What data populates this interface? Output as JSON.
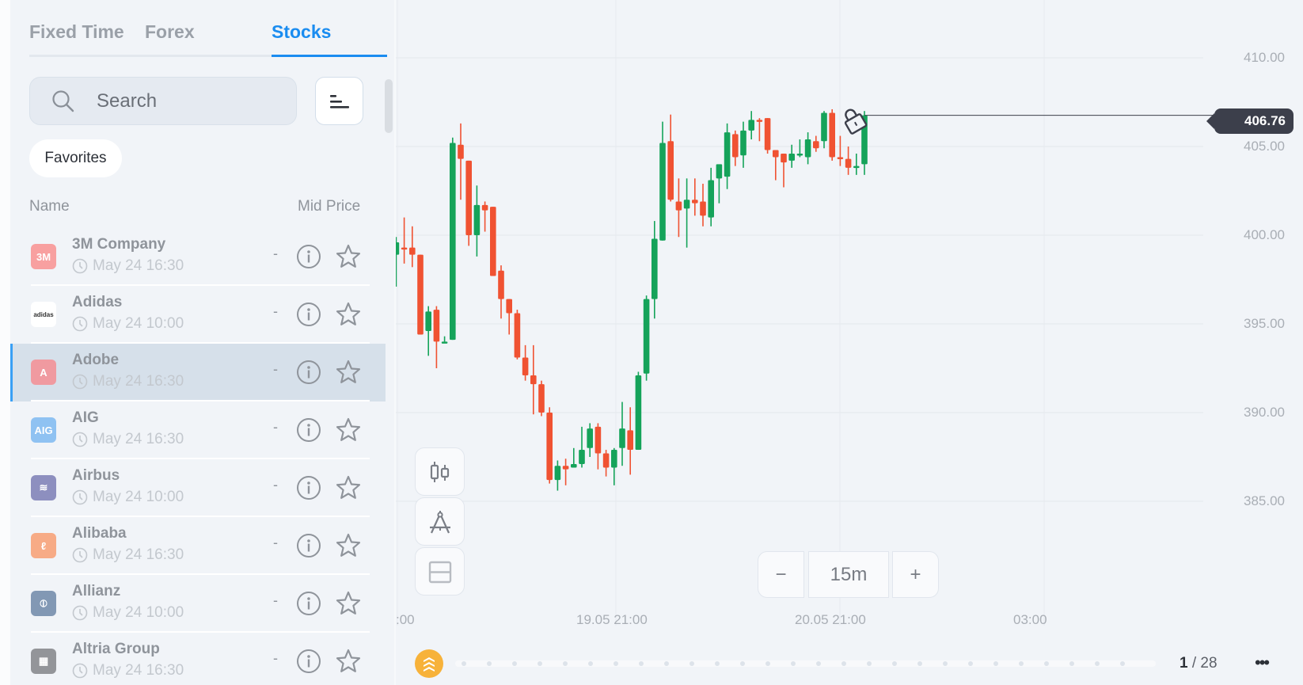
{
  "sidebar": {
    "tabs": [
      {
        "label": "Fixed Time",
        "active": false
      },
      {
        "label": "Forex",
        "active": false
      },
      {
        "label": "Stocks",
        "active": true
      }
    ],
    "search": {
      "placeholder": "Search",
      "value": ""
    },
    "sort_icon": "sort-lines-icon",
    "favorites_label": "Favorites",
    "columns": {
      "name": "Name",
      "price": "Mid Price"
    },
    "items": [
      {
        "name": "3M Company",
        "time": "May 24 16:30",
        "price": "-",
        "logo_text": "3M",
        "logo_color": "#f8a0a0",
        "selected": false
      },
      {
        "name": "Adidas",
        "time": "May 24 10:00",
        "price": "-",
        "logo_text": "adidas",
        "logo_color": "#ffffff",
        "selected": false
      },
      {
        "name": "Adobe",
        "time": "May 24 16:30",
        "price": "-",
        "logo_text": "A",
        "logo_color": "#f09aa0",
        "selected": true
      },
      {
        "name": "AIG",
        "time": "May 24 16:30",
        "price": "-",
        "logo_text": "AIG",
        "logo_color": "#8fc2f2",
        "selected": false
      },
      {
        "name": "Airbus",
        "time": "May 24 10:00",
        "price": "-",
        "logo_text": "≋",
        "logo_color": "#8d8fbf",
        "selected": false
      },
      {
        "name": "Alibaba",
        "time": "May 24 16:30",
        "price": "-",
        "logo_text": "ℓ",
        "logo_color": "#f7ab86",
        "selected": false
      },
      {
        "name": "Allianz",
        "time": "May 24 10:00",
        "price": "-",
        "logo_text": "⦶",
        "logo_color": "#8298b4",
        "selected": false
      },
      {
        "name": "Altria Group",
        "time": "May 24 16:30",
        "price": "-",
        "logo_text": "▦",
        "logo_color": "#939599",
        "selected": false
      }
    ]
  },
  "chart": {
    "current_price": "406.76",
    "y_ticks": [
      "410.00",
      "405.00",
      "400.00",
      "395.00",
      "390.00",
      "385.00"
    ],
    "x_ticks": [
      ":00",
      "19.05 21:00",
      "20.05 21:00",
      "03:00"
    ],
    "timeframe": "15m",
    "zoom_minus": "−",
    "zoom_plus": "+",
    "colors": {
      "up": "#15a35a",
      "down": "#f05232",
      "price_tag": "#3c3f4b"
    },
    "page_current": "1",
    "page_total": "/ 28",
    "more_label": "•••"
  },
  "chart_data": {
    "type": "candlestick",
    "title": "",
    "ylim": [
      382.5,
      413
    ],
    "y_ticks": [
      410,
      405,
      400,
      395,
      390,
      385
    ],
    "x_tick_labels": [
      ":00",
      "19.05 21:00",
      "20.05 21:00",
      "03:00"
    ],
    "last_price": 406.76,
    "candles": [
      {
        "o": 400.0,
        "h": 400.1,
        "c": 398.6,
        "l": 396.4
      },
      {
        "o": 398.6,
        "h": 399.1,
        "c": 398.4,
        "l": 397.0
      },
      {
        "o": 398.9,
        "h": 399.9,
        "c": 399.6,
        "l": 397.1
      },
      {
        "o": 399.3,
        "h": 401.0,
        "c": 399.2,
        "l": 398.4
      },
      {
        "o": 399.3,
        "h": 400.5,
        "c": 398.9,
        "l": 398.2
      },
      {
        "o": 398.9,
        "h": 398.9,
        "c": 394.4,
        "l": 394.4
      },
      {
        "o": 394.6,
        "h": 396.0,
        "c": 395.7,
        "l": 393.2
      },
      {
        "o": 395.8,
        "h": 396.0,
        "c": 394.0,
        "l": 392.5
      },
      {
        "o": 394.0,
        "h": 394.3,
        "c": 394.0,
        "l": 394.0
      },
      {
        "o": 394.1,
        "h": 405.5,
        "c": 405.2,
        "l": 394.1
      },
      {
        "o": 405.1,
        "h": 406.3,
        "c": 404.3,
        "l": 402.0
      },
      {
        "o": 404.2,
        "h": 404.2,
        "c": 400.0,
        "l": 399.4
      },
      {
        "o": 400.0,
        "h": 402.8,
        "c": 401.7,
        "l": 398.8
      },
      {
        "o": 401.7,
        "h": 401.9,
        "c": 401.4,
        "l": 400.2
      },
      {
        "o": 401.6,
        "h": 401.6,
        "c": 397.7,
        "l": 397.7
      },
      {
        "o": 398.0,
        "h": 398.3,
        "c": 396.4,
        "l": 395.3
      },
      {
        "o": 396.4,
        "h": 396.4,
        "c": 395.6,
        "l": 394.4
      },
      {
        "o": 395.6,
        "h": 395.8,
        "c": 393.1,
        "l": 393.0
      },
      {
        "o": 393.1,
        "h": 393.8,
        "c": 392.1,
        "l": 391.8
      },
      {
        "o": 392.1,
        "h": 393.8,
        "c": 391.6,
        "l": 389.9
      },
      {
        "o": 391.6,
        "h": 391.8,
        "c": 390.0,
        "l": 389.8
      },
      {
        "o": 390.0,
        "h": 390.3,
        "c": 386.2,
        "l": 386.0
      },
      {
        "o": 386.2,
        "h": 387.3,
        "c": 387.0,
        "l": 385.6
      },
      {
        "o": 387.0,
        "h": 387.4,
        "c": 386.8,
        "l": 385.9
      },
      {
        "o": 386.9,
        "h": 388.0,
        "c": 387.1,
        "l": 386.9
      },
      {
        "o": 387.1,
        "h": 389.2,
        "c": 387.9,
        "l": 386.9
      },
      {
        "o": 388.0,
        "h": 389.4,
        "c": 389.1,
        "l": 387.5
      },
      {
        "o": 389.2,
        "h": 389.4,
        "c": 387.7,
        "l": 386.8
      },
      {
        "o": 387.7,
        "h": 387.9,
        "c": 386.9,
        "l": 386.4
      },
      {
        "o": 386.9,
        "h": 388.0,
        "c": 387.9,
        "l": 385.9
      },
      {
        "o": 388.0,
        "h": 390.6,
        "c": 389.1,
        "l": 387.0
      },
      {
        "o": 389.0,
        "h": 390.3,
        "c": 387.9,
        "l": 386.5
      },
      {
        "o": 387.9,
        "h": 392.3,
        "c": 392.1,
        "l": 387.9
      },
      {
        "o": 392.2,
        "h": 396.6,
        "c": 396.4,
        "l": 391.8
      },
      {
        "o": 396.4,
        "h": 400.8,
        "c": 399.8,
        "l": 395.3
      },
      {
        "o": 399.7,
        "h": 406.4,
        "c": 405.2,
        "l": 399.7
      },
      {
        "o": 405.3,
        "h": 406.8,
        "c": 402.0,
        "l": 401.9
      },
      {
        "o": 401.9,
        "h": 403.2,
        "c": 401.4,
        "l": 399.9
      },
      {
        "o": 401.5,
        "h": 403.2,
        "c": 402.0,
        "l": 399.3
      },
      {
        "o": 402.0,
        "h": 403.2,
        "c": 401.8,
        "l": 401.1
      },
      {
        "o": 401.9,
        "h": 402.9,
        "c": 401.1,
        "l": 400.5
      },
      {
        "o": 401.0,
        "h": 403.8,
        "c": 403.1,
        "l": 400.5
      },
      {
        "o": 403.2,
        "h": 403.9,
        "c": 404.0,
        "l": 401.8
      },
      {
        "o": 403.3,
        "h": 406.3,
        "c": 405.8,
        "l": 402.6
      },
      {
        "o": 405.7,
        "h": 405.9,
        "c": 404.4,
        "l": 403.9
      },
      {
        "o": 404.5,
        "h": 406.4,
        "c": 405.9,
        "l": 403.8
      },
      {
        "o": 405.9,
        "h": 407.0,
        "c": 406.5,
        "l": 405.4
      },
      {
        "o": 406.5,
        "h": 406.6,
        "c": 406.4,
        "l": 405.3
      },
      {
        "o": 406.6,
        "h": 406.6,
        "c": 404.8,
        "l": 404.6
      },
      {
        "o": 404.8,
        "h": 404.8,
        "c": 404.4,
        "l": 403.1
      },
      {
        "o": 404.6,
        "h": 404.6,
        "c": 404.1,
        "l": 402.7
      },
      {
        "o": 404.2,
        "h": 405.1,
        "c": 404.6,
        "l": 403.8
      },
      {
        "o": 404.6,
        "h": 405.4,
        "c": 404.6,
        "l": 404.4
      },
      {
        "o": 404.4,
        "h": 405.8,
        "c": 405.4,
        "l": 404.0
      },
      {
        "o": 405.3,
        "h": 405.6,
        "c": 404.9,
        "l": 404.7
      },
      {
        "o": 405.3,
        "h": 407.0,
        "c": 406.9,
        "l": 404.9
      },
      {
        "o": 406.9,
        "h": 407.1,
        "c": 404.4,
        "l": 404.2
      },
      {
        "o": 404.4,
        "h": 405.6,
        "c": 404.3,
        "l": 403.9
      },
      {
        "o": 404.3,
        "h": 405.0,
        "c": 403.8,
        "l": 403.4
      },
      {
        "o": 403.9,
        "h": 404.6,
        "c": 403.9,
        "l": 403.4
      },
      {
        "o": 404.0,
        "h": 407.0,
        "c": 406.76,
        "l": 403.4
      }
    ]
  }
}
